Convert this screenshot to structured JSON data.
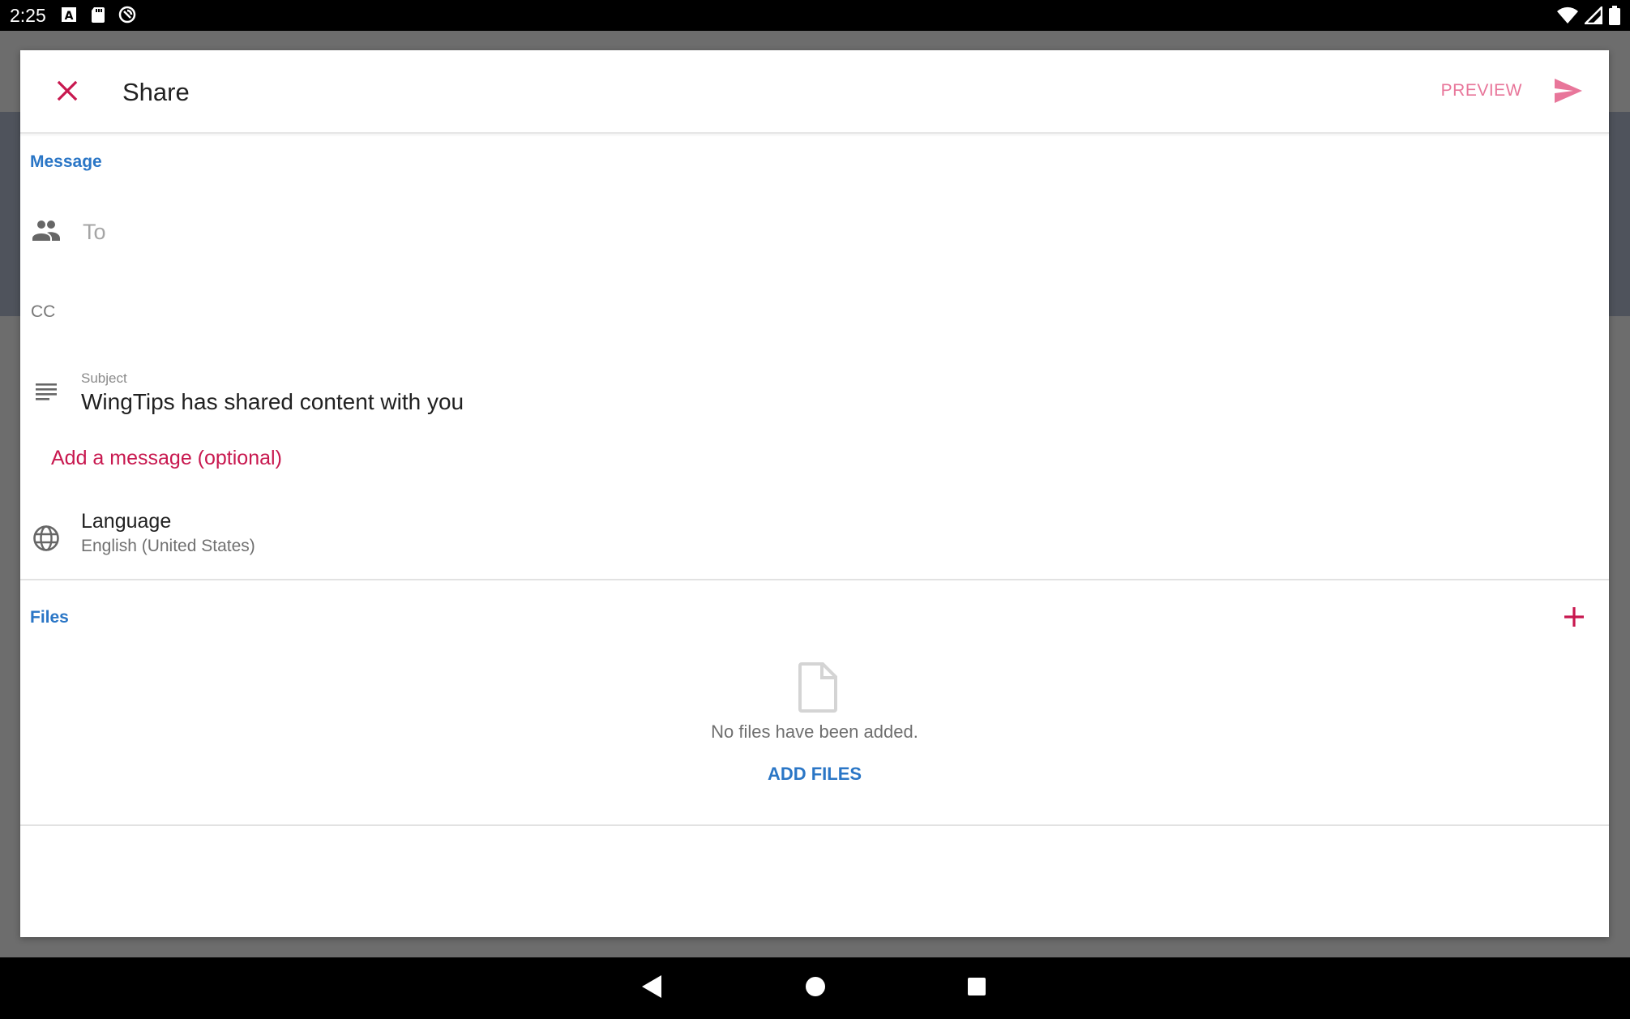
{
  "status_bar": {
    "time": "2:25",
    "left_icons": [
      "font-a-icon",
      "sd-card-icon",
      "sync-circle-icon"
    ],
    "right_icons": [
      "wifi-icon",
      "cell-signal-icon",
      "battery-icon"
    ]
  },
  "dialog": {
    "title": "Share",
    "preview_label": "PREVIEW",
    "accent_color": "#c8184f",
    "link_color": "#2a76c6"
  },
  "message": {
    "section_label": "Message",
    "to_placeholder": "To",
    "cc_label": "CC",
    "subject_caption": "Subject",
    "subject_value": "WingTips has shared content with you",
    "add_message_label": "Add a message (optional)",
    "language_title": "Language",
    "language_value": "English (United States)"
  },
  "files": {
    "section_label": "Files",
    "empty_text": "No files have been added.",
    "add_files_label": "ADD FILES"
  }
}
